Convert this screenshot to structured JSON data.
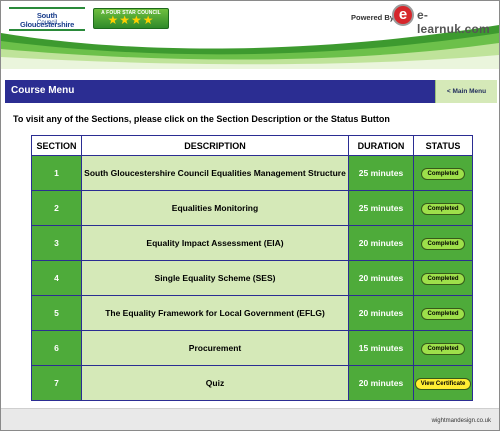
{
  "header": {
    "council_logo": {
      "name": "South Gloucestershire",
      "sub": "Council"
    },
    "badge": {
      "title": "A FOUR STAR COUNCIL",
      "stars": "★★★★"
    },
    "powered_by": "Powered By",
    "elearn_letter": "e",
    "elearn_text": "e-learnuk.com",
    "colors": {
      "green": "#3d9a2f",
      "navy": "#1b3e8c",
      "red": "#d6262b"
    }
  },
  "titlebar": {
    "title": "Course Menu",
    "main_menu": "< Main Menu",
    "color": "#2b2d92"
  },
  "instruction": "To visit any of the Sections, please click on the Section Description or the Status Button",
  "table": {
    "headers": {
      "section": "SECTION",
      "description": "DESCRIPTION",
      "duration": "DURATION",
      "status": "STATUS"
    },
    "rows": [
      {
        "section": "1",
        "description": "South Gloucestershire Council Equalities Management Structure",
        "duration": "25 minutes",
        "status": "Completed"
      },
      {
        "section": "2",
        "description": "Equalities Monitoring",
        "duration": "25 minutes",
        "status": "Completed"
      },
      {
        "section": "3",
        "description": "Equality Impact Assessment (EIA)",
        "duration": "20 minutes",
        "status": "Completed"
      },
      {
        "section": "4",
        "description": "Single Equality Scheme (SES)",
        "duration": "20 minutes",
        "status": "Completed"
      },
      {
        "section": "5",
        "description": "The Equality Framework for Local Government (EFLG)",
        "duration": "20 minutes",
        "status": "Completed"
      },
      {
        "section": "6",
        "description": "Procurement",
        "duration": "15 minutes",
        "status": "Completed"
      },
      {
        "section": "7",
        "description": "Quiz",
        "duration": "20 minutes",
        "status": "View Certificate"
      }
    ],
    "colors": {
      "green": "#4eab3a",
      "light_green": "#d5e9b8",
      "completed": "#9ee04a",
      "certificate": "#ffee33"
    }
  },
  "footer": {
    "credit": "wightmandesign.co.uk"
  }
}
